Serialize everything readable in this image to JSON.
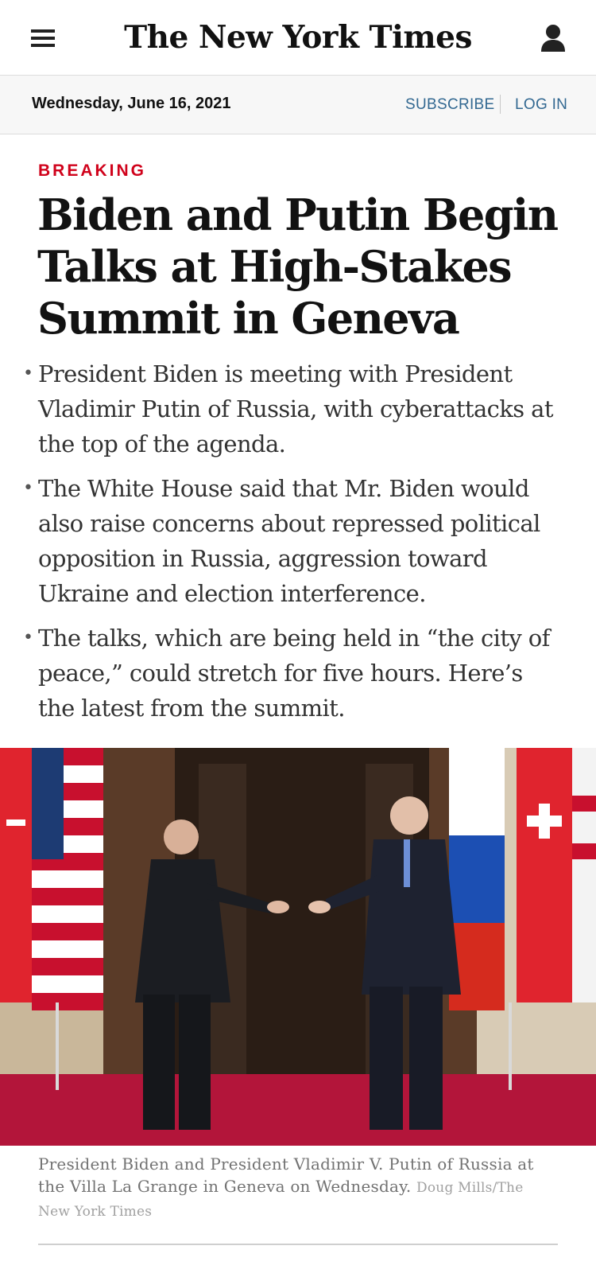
{
  "header": {
    "masthead": "The New York Times",
    "menu_icon": "hamburger-menu-icon",
    "account_icon": "user-account-icon"
  },
  "datebar": {
    "date": "Wednesday, June 16, 2021",
    "subscribe": "SUBSCRIBE",
    "login": "LOG IN"
  },
  "article": {
    "kicker": "BREAKING",
    "headline": "Biden and Putin Begin Talks at High-Stakes Summit in Geneva",
    "summary": [
      "President Biden is meeting with President Vladimir Putin of Russia, with cyberattacks at the top of the agenda.",
      "The White House said that Mr. Biden would also raise concerns about repressed political opposition in Russia, aggression toward Ukraine and election interference.",
      "The talks, which are being held in “the city of peace,” could stretch for five hours. Here’s the latest from the summit."
    ],
    "caption": "President Biden and President Vladimir V. Putin of Russia at the Villa La Grange in Geneva on Wednesday.",
    "credit": "Doug Mills/The New York Times"
  },
  "colors": {
    "kicker": "#d0021b",
    "link": "#326891",
    "text": "#121212"
  }
}
